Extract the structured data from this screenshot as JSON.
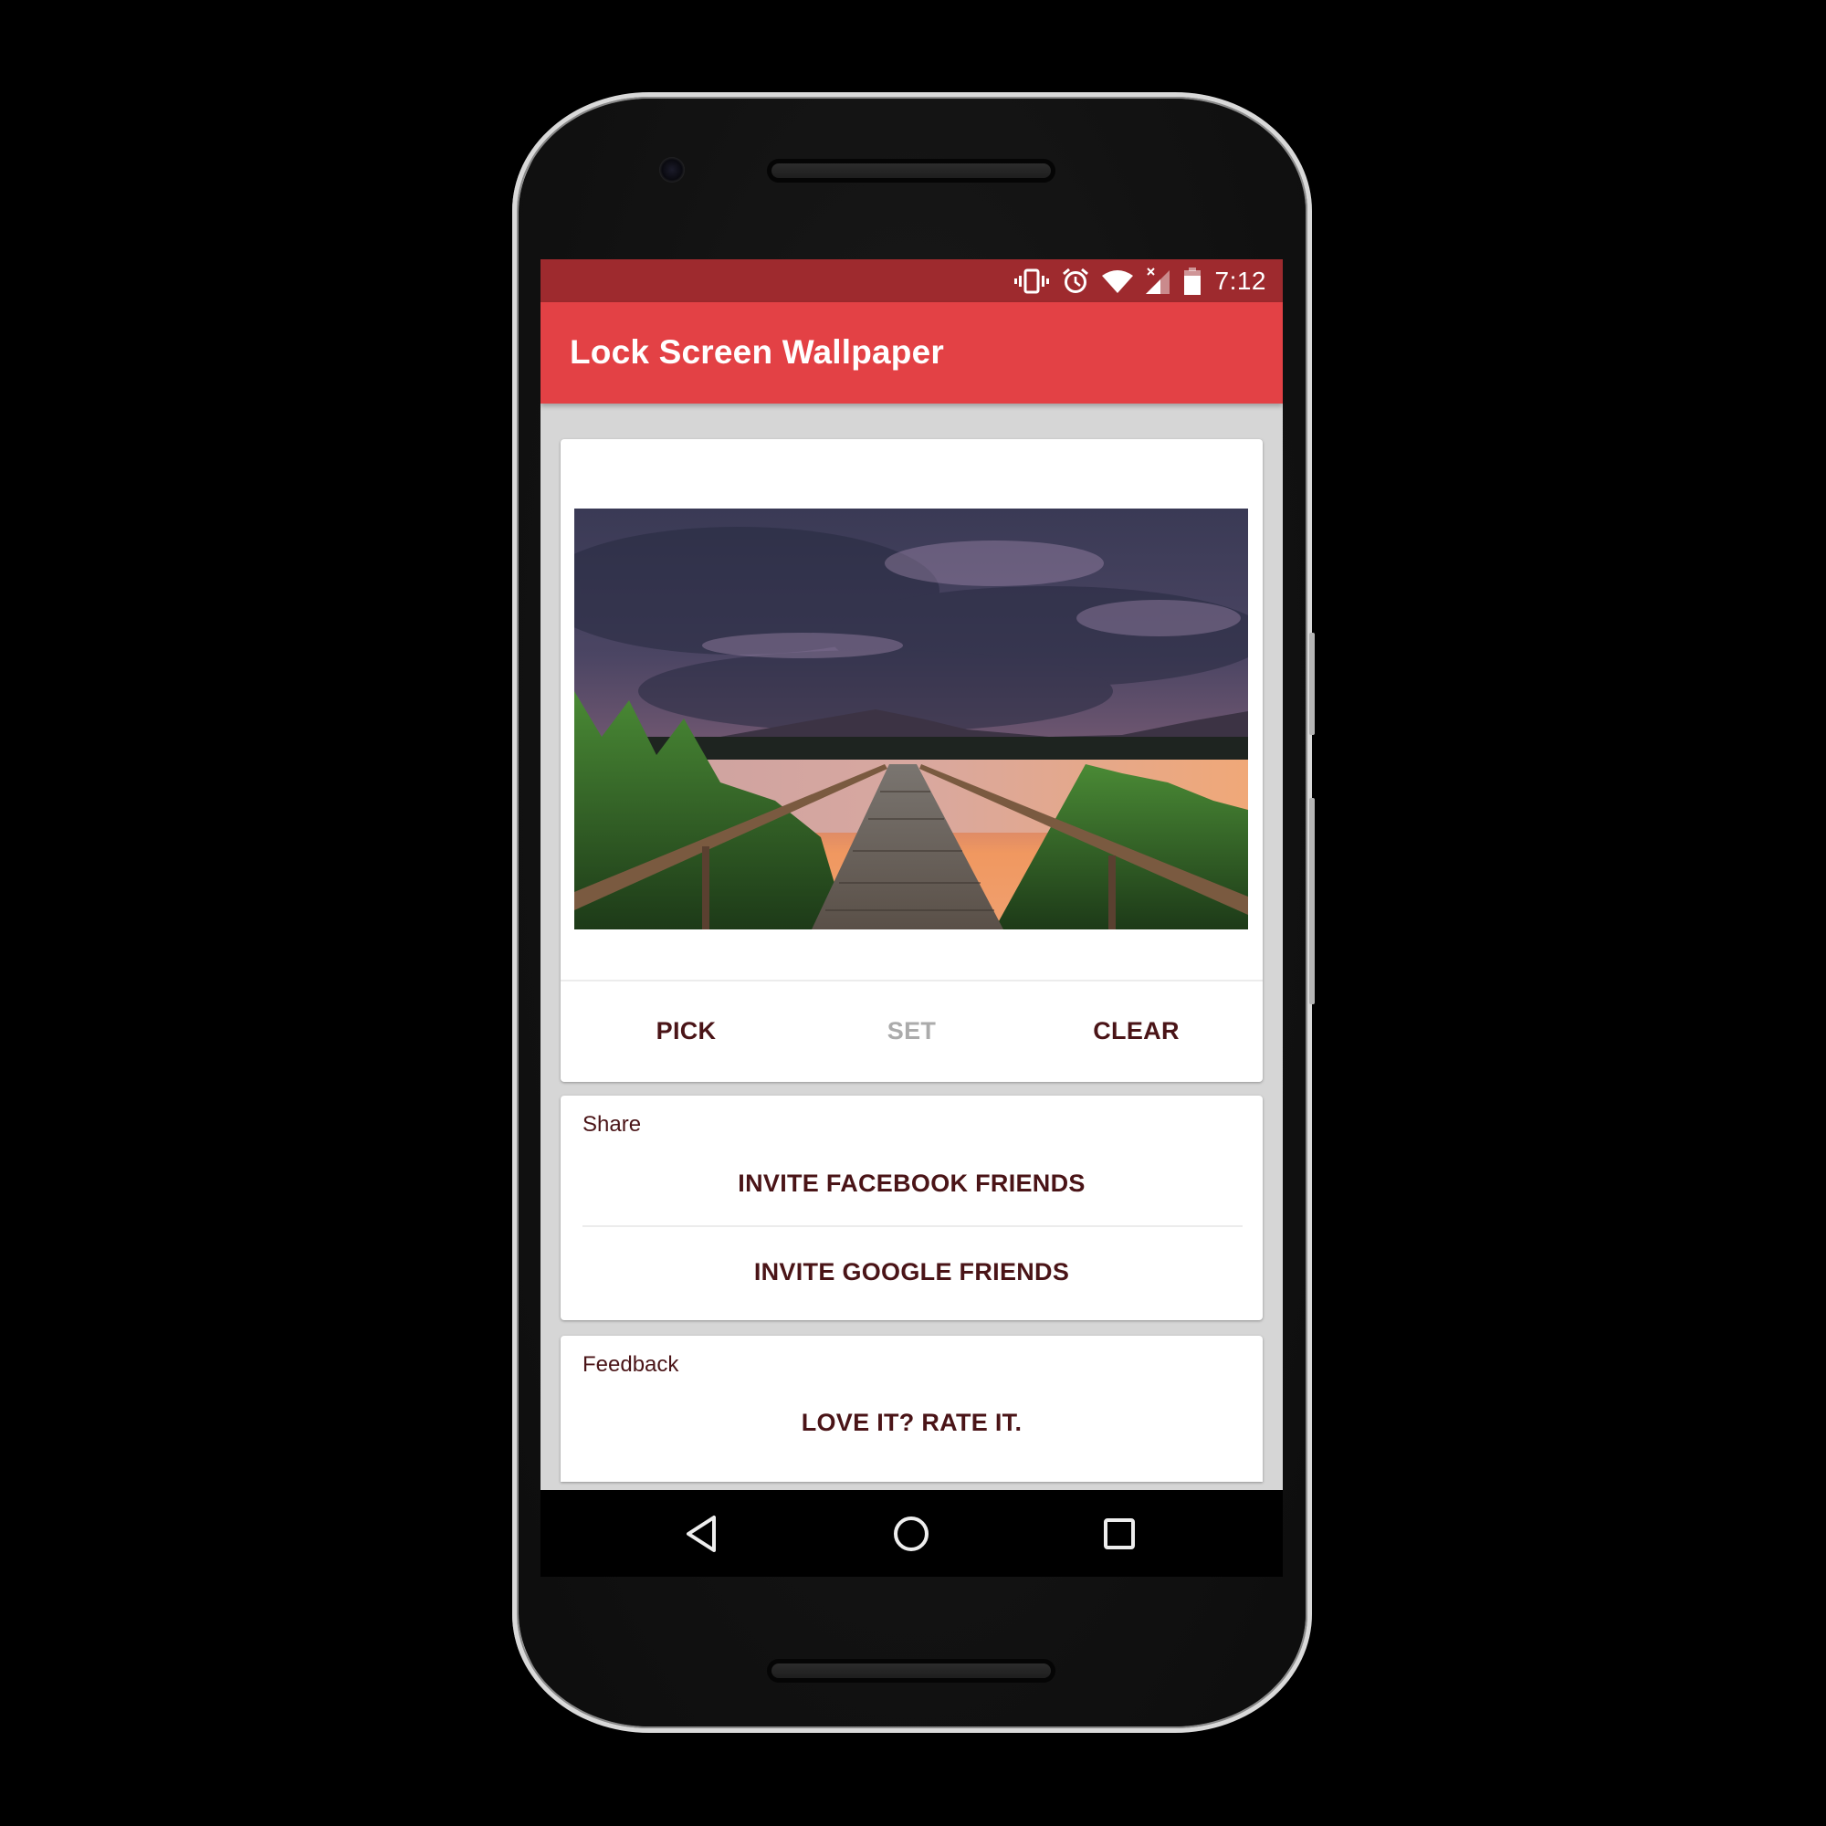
{
  "status_bar": {
    "time": "7:12",
    "icons": [
      "vibrate-icon",
      "alarm-icon",
      "wifi-icon",
      "cell-signal-no-service-icon",
      "battery-icon"
    ]
  },
  "app_bar": {
    "title": "Lock Screen Wallpaper"
  },
  "wallpaper_card": {
    "image_description": "Sunset over a lake with a wooden boardwalk through tall grass",
    "actions": [
      {
        "label": "PICK",
        "enabled": true
      },
      {
        "label": "SET",
        "enabled": false
      },
      {
        "label": "CLEAR",
        "enabled": true
      }
    ]
  },
  "share_card": {
    "label": "Share",
    "buttons": [
      "INVITE FACEBOOK FRIENDS",
      "INVITE GOOGLE FRIENDS"
    ]
  },
  "feedback_card": {
    "label": "Feedback",
    "buttons": [
      "LOVE IT? RATE IT."
    ]
  },
  "nav_bar": {
    "buttons": [
      "back",
      "home",
      "recents"
    ]
  },
  "colors": {
    "status_bar": "#9e2a2e",
    "app_bar": "#e34145",
    "background": "#d6d6d6",
    "button_text": "#4a1417",
    "disabled_text": "#ababab"
  }
}
